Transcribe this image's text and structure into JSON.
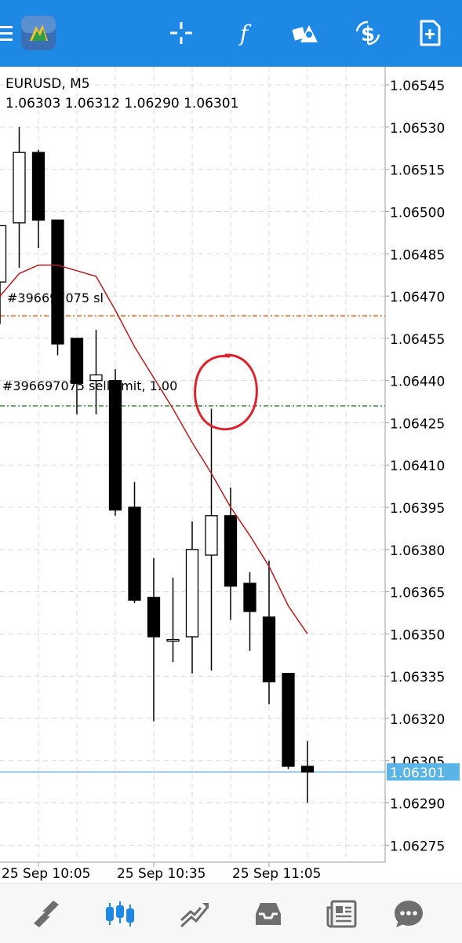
{
  "toolbar": {
    "icons": [
      "menu-icon",
      "app-logo-icon",
      "crosshair-icon",
      "indicators-icon",
      "objects-icon",
      "symbol-dollar-icon",
      "new-order-icon"
    ]
  },
  "chart": {
    "symbol_timeframe": "EURUSD, M5",
    "ohlc": "1.06303 1.06312 1.06290 1.06301",
    "sl_label": "#396697075 sl",
    "order_label": "#396697075 sell limit, 1.00",
    "current_price": "1.06301",
    "colors": {
      "bull": "#ffffff",
      "bear": "#000000",
      "ma": "#b71c1c",
      "sl_line": "#e65100",
      "order_line": "#2e7d32",
      "bid_line": "#5ab4e6",
      "price_tag": "#5ab4e6",
      "annotation": "#e0202a"
    }
  },
  "chart_data": {
    "type": "candlestick",
    "ylim": [
      1.06262,
      1.06552
    ],
    "y_ticks": [
      "1.06545",
      "1.06530",
      "1.06515",
      "1.06500",
      "1.06485",
      "1.06470",
      "1.06455",
      "1.06440",
      "1.06425",
      "1.06410",
      "1.06395",
      "1.06380",
      "1.06365",
      "1.06350",
      "1.06335",
      "1.06320",
      "1.06305",
      "1.06290",
      "1.06275"
    ],
    "x_ticks": [
      "25 Sep 10:05",
      "25 Sep 10:35",
      "25 Sep 11:05"
    ],
    "candles": [
      {
        "o": 1.06475,
        "h": 1.06495,
        "l": 1.0646,
        "c": 1.06495
      },
      {
        "o": 1.06496,
        "h": 1.0653,
        "l": 1.0648,
        "c": 1.06521
      },
      {
        "o": 1.06521,
        "h": 1.06522,
        "l": 1.06487,
        "c": 1.06497
      },
      {
        "o": 1.06497,
        "h": 1.06497,
        "l": 1.06449,
        "c": 1.06453
      },
      {
        "o": 1.06455,
        "h": 1.06455,
        "l": 1.06428,
        "c": 1.06439
      },
      {
        "o": 1.0644,
        "h": 1.06458,
        "l": 1.06428,
        "c": 1.06442
      },
      {
        "o": 1.0644,
        "h": 1.06444,
        "l": 1.06392,
        "c": 1.06394
      },
      {
        "o": 1.06395,
        "h": 1.06404,
        "l": 1.06361,
        "c": 1.06362
      },
      {
        "o": 1.06363,
        "h": 1.06377,
        "l": 1.06319,
        "c": 1.06349
      },
      {
        "o": 1.06348,
        "h": 1.0637,
        "l": 1.0634,
        "c": 1.06348
      },
      {
        "o": 1.06349,
        "h": 1.0639,
        "l": 1.06336,
        "c": 1.0638
      },
      {
        "o": 1.06378,
        "h": 1.0643,
        "l": 1.06337,
        "c": 1.06392
      },
      {
        "o": 1.06392,
        "h": 1.06402,
        "l": 1.06355,
        "c": 1.06367
      },
      {
        "o": 1.06368,
        "h": 1.06372,
        "l": 1.06344,
        "c": 1.06358
      },
      {
        "o": 1.06356,
        "h": 1.06376,
        "l": 1.06325,
        "c": 1.06333
      },
      {
        "o": 1.06336,
        "h": 1.06336,
        "l": 1.06302,
        "c": 1.06303
      },
      {
        "o": 1.06303,
        "h": 1.06312,
        "l": 1.0629,
        "c": 1.06301
      }
    ],
    "ma": [
      1.0647,
      1.06478,
      1.06481,
      1.06481,
      1.06479,
      1.06477,
      1.06465,
      1.06452,
      1.06441,
      1.0643,
      1.06418,
      1.06407,
      1.06395,
      1.06385,
      1.06374,
      1.0636,
      1.0635
    ],
    "sl_price": 1.06463,
    "order_price": 1.06431,
    "current_price": 1.06301
  },
  "bottom_nav": {
    "items": [
      "quotes-icon",
      "chart-icon",
      "trade-icon",
      "history-icon",
      "news-icon",
      "chat-icon"
    ],
    "active_index": 1,
    "active_color": "#1e88e5",
    "inactive_color": "#6e6e6e"
  }
}
